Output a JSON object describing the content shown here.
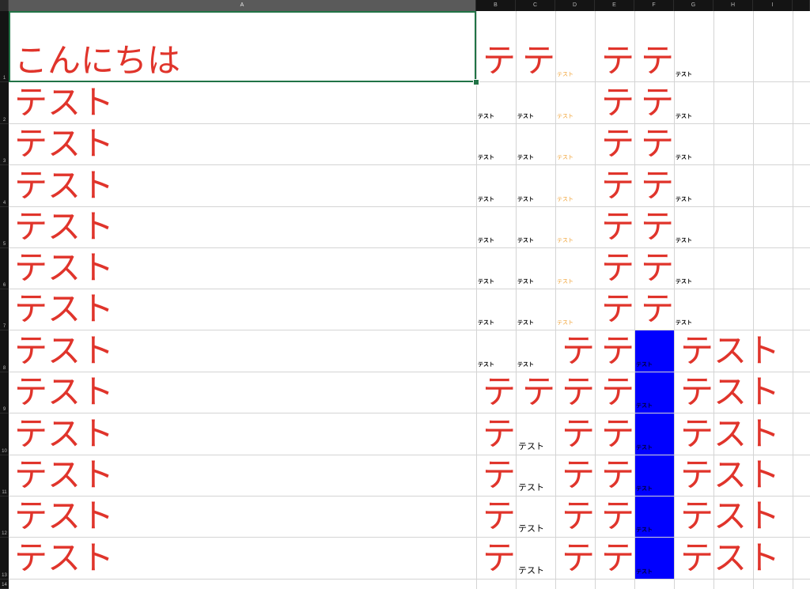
{
  "columns": [
    "A",
    "B",
    "C",
    "D",
    "E",
    "F",
    "G",
    "H",
    "I"
  ],
  "rows": [
    "1",
    "2",
    "3",
    "4",
    "5",
    "6",
    "7",
    "8",
    "9",
    "10",
    "11",
    "12",
    "13",
    "14"
  ],
  "selected": {
    "column": "A",
    "cell": "A1"
  },
  "cells": {
    "A1": "こんにちは",
    "A2": "テスト",
    "A3": "テスト",
    "A4": "テスト",
    "A5": "テスト",
    "A6": "テスト",
    "A7": "テスト",
    "A8": "テスト",
    "A9": "テスト",
    "A10": "テスト",
    "A11": "テスト",
    "A12": "テスト",
    "A13": "テスト",
    "B1": "テ",
    "C1": "テ",
    "D1": "テスト",
    "E1": "テ",
    "F1": "テ",
    "G1": "テスト",
    "B2": "テスト",
    "C2": "テスト",
    "D2": "テスト",
    "E2": "テ",
    "F2": "テ",
    "G2": "テスト",
    "B3": "テスト",
    "C3": "テスト",
    "D3": "テスト",
    "E3": "テ",
    "F3": "テ",
    "G3": "テスト",
    "B4": "テスト",
    "C4": "テスト",
    "D4": "テスト",
    "E4": "テ",
    "F4": "テ",
    "G4": "テスト",
    "B5": "テスト",
    "C5": "テスト",
    "D5": "テスト",
    "E5": "テ",
    "F5": "テ",
    "G5": "テスト",
    "B6": "テスト",
    "C6": "テスト",
    "D6": "テスト",
    "E6": "テ",
    "F6": "テ",
    "G6": "テスト",
    "B7": "テスト",
    "C7": "テスト",
    "D7": "テスト",
    "E7": "テ",
    "F7": "テ",
    "G7": "テスト",
    "B8": "テスト",
    "C8": "テスト",
    "D8": "テ",
    "E8": "テ",
    "F8": "テスト",
    "G8": "テスト",
    "B9": "テ",
    "C9": "テ",
    "D9": "テ",
    "E9": "テ",
    "F9": "テスト",
    "G9": "テスト",
    "B10": "テ",
    "C10": "テスト",
    "D10": "テ",
    "E10": "テ",
    "F10": "テスト",
    "G10": "テスト",
    "B11": "テ",
    "C11": "テスト",
    "D11": "テ",
    "E11": "テ",
    "F11": "テスト",
    "G11": "テスト",
    "B12": "テ",
    "C12": "テスト",
    "D12": "テ",
    "E12": "テ",
    "F12": "テスト",
    "G12": "テスト",
    "B13": "テ",
    "C13": "テスト",
    "D13": "テ",
    "E13": "テ",
    "F13": "テスト",
    "G13": "テスト"
  },
  "colors": {
    "header_bg": "#141414",
    "header_selected_bg": "#5a5a5a",
    "grid_line": "#d4d4d4",
    "red_text": "#e0342b",
    "orange_text": "#f0a030",
    "blue_fill": "#0000ff",
    "selection": "#217346"
  }
}
